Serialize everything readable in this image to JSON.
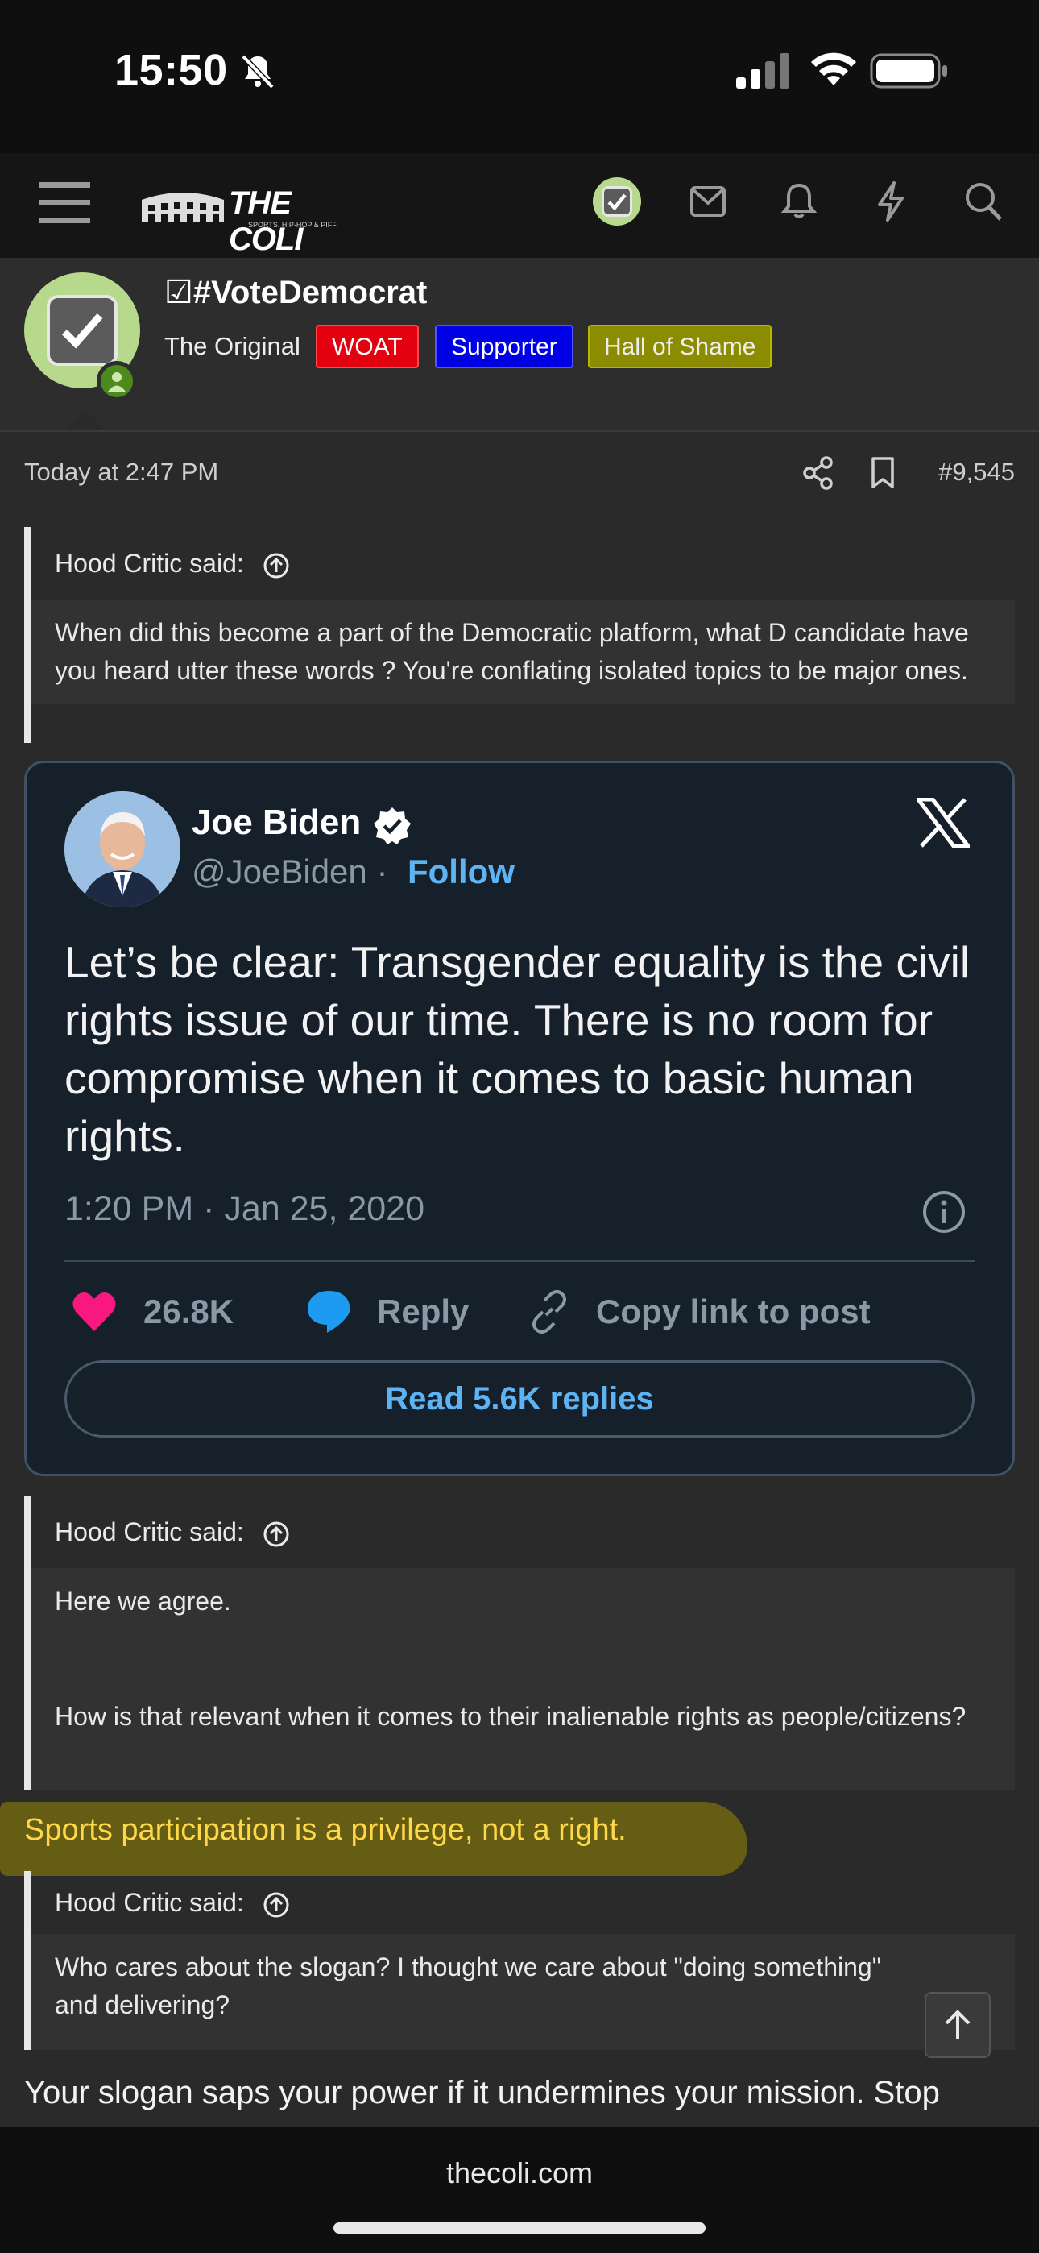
{
  "status": {
    "time": "15:50"
  },
  "nav": {
    "logo_text": "THE COLI",
    "logo_sub": "SPORTS, HIP-HOP & PIFF"
  },
  "user": {
    "name": "☑#VoteDemocrat",
    "title": "The Original",
    "badges": [
      "WOAT",
      "Supporter",
      "Hall of Shame"
    ]
  },
  "post": {
    "date": "Today at 2:47 PM",
    "number": "#9,545"
  },
  "quote1": {
    "author": "Hood Critic said:",
    "text": "When did this become a part of the Democratic platform, what D candidate have you heard utter these words ? You're conflating isolated topics to be major ones."
  },
  "tweet": {
    "name": "Joe Biden",
    "handle": "@JoeBiden",
    "separator": "·",
    "follow": "Follow",
    "text": "Let’s be clear: Transgender equality is the civil rights issue of our time. There is no room for compromise when it comes to basic human rights.",
    "date": "1:20 PM · Jan 25, 2020",
    "likes": "26.8K",
    "reply": "Reply",
    "copy_link": "Copy link to post",
    "read_replies": "Read 5.6K replies"
  },
  "quote2": {
    "author": "Hood Critic said:",
    "line1": "Here we agree.",
    "line2": "How is that relevant when it comes to their inalienable rights as people/citizens?"
  },
  "reply_highlight": "Sports participation is a privilege, not a right.",
  "quote3": {
    "author": "Hood Critic said:",
    "text": "Who cares about the slogan? I thought we care about \"doing something\" and delivering?"
  },
  "tail": "Your slogan saps your power if it undermines your mission. Stop",
  "browser": {
    "domain": "thecoli.com"
  },
  "colors": {
    "highlight": "#6b6212",
    "tweet_bg": "#15202b",
    "link_blue": "#5eb4f2",
    "like_pink": "#f91880"
  }
}
